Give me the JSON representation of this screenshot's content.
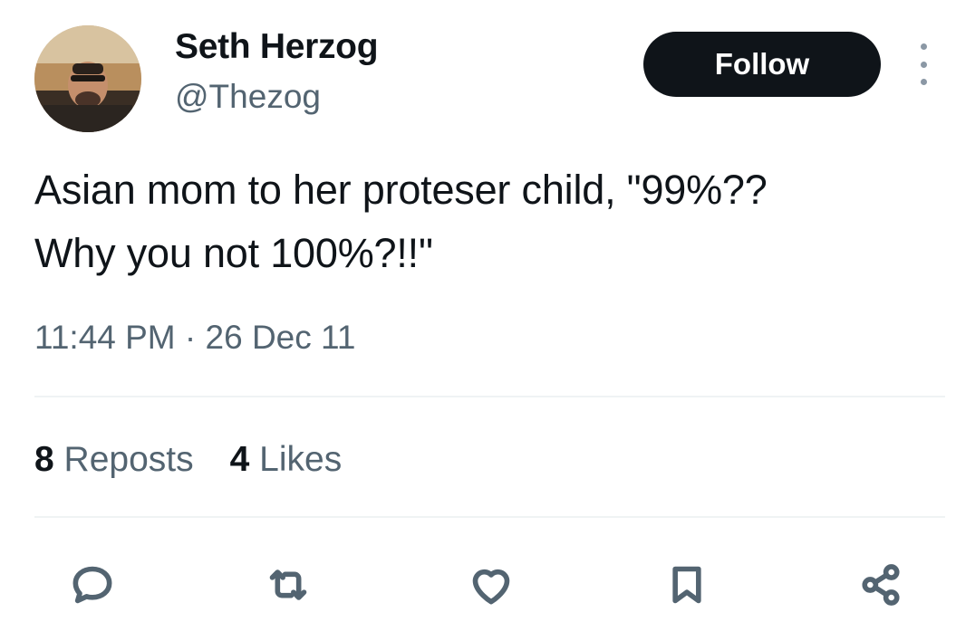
{
  "author": {
    "name": "Seth Herzog",
    "handle": "@Thezog"
  },
  "follow_label": "Follow",
  "tweet": {
    "text": "Asian mom to her proteser child, \"99%??\nWhy you not 100%?!!\"",
    "time": "11:44 PM",
    "separator": " · ",
    "date": "26 Dec 11"
  },
  "stats": {
    "reposts_count": "8",
    "reposts_label": "Reposts",
    "likes_count": "4",
    "likes_label": "Likes"
  },
  "actions": {
    "reply_icon": "speech-bubble-icon",
    "repost_icon": "repost-arrows-icon",
    "like_icon": "heart-icon",
    "bookmark_icon": "bookmark-icon",
    "share_icon": "share-nodes-icon"
  },
  "colors": {
    "text_primary": "#0f1419",
    "text_secondary": "#536471",
    "follow_bg": "#0f1419",
    "follow_text": "#ffffff",
    "divider": "#eff3f4"
  }
}
